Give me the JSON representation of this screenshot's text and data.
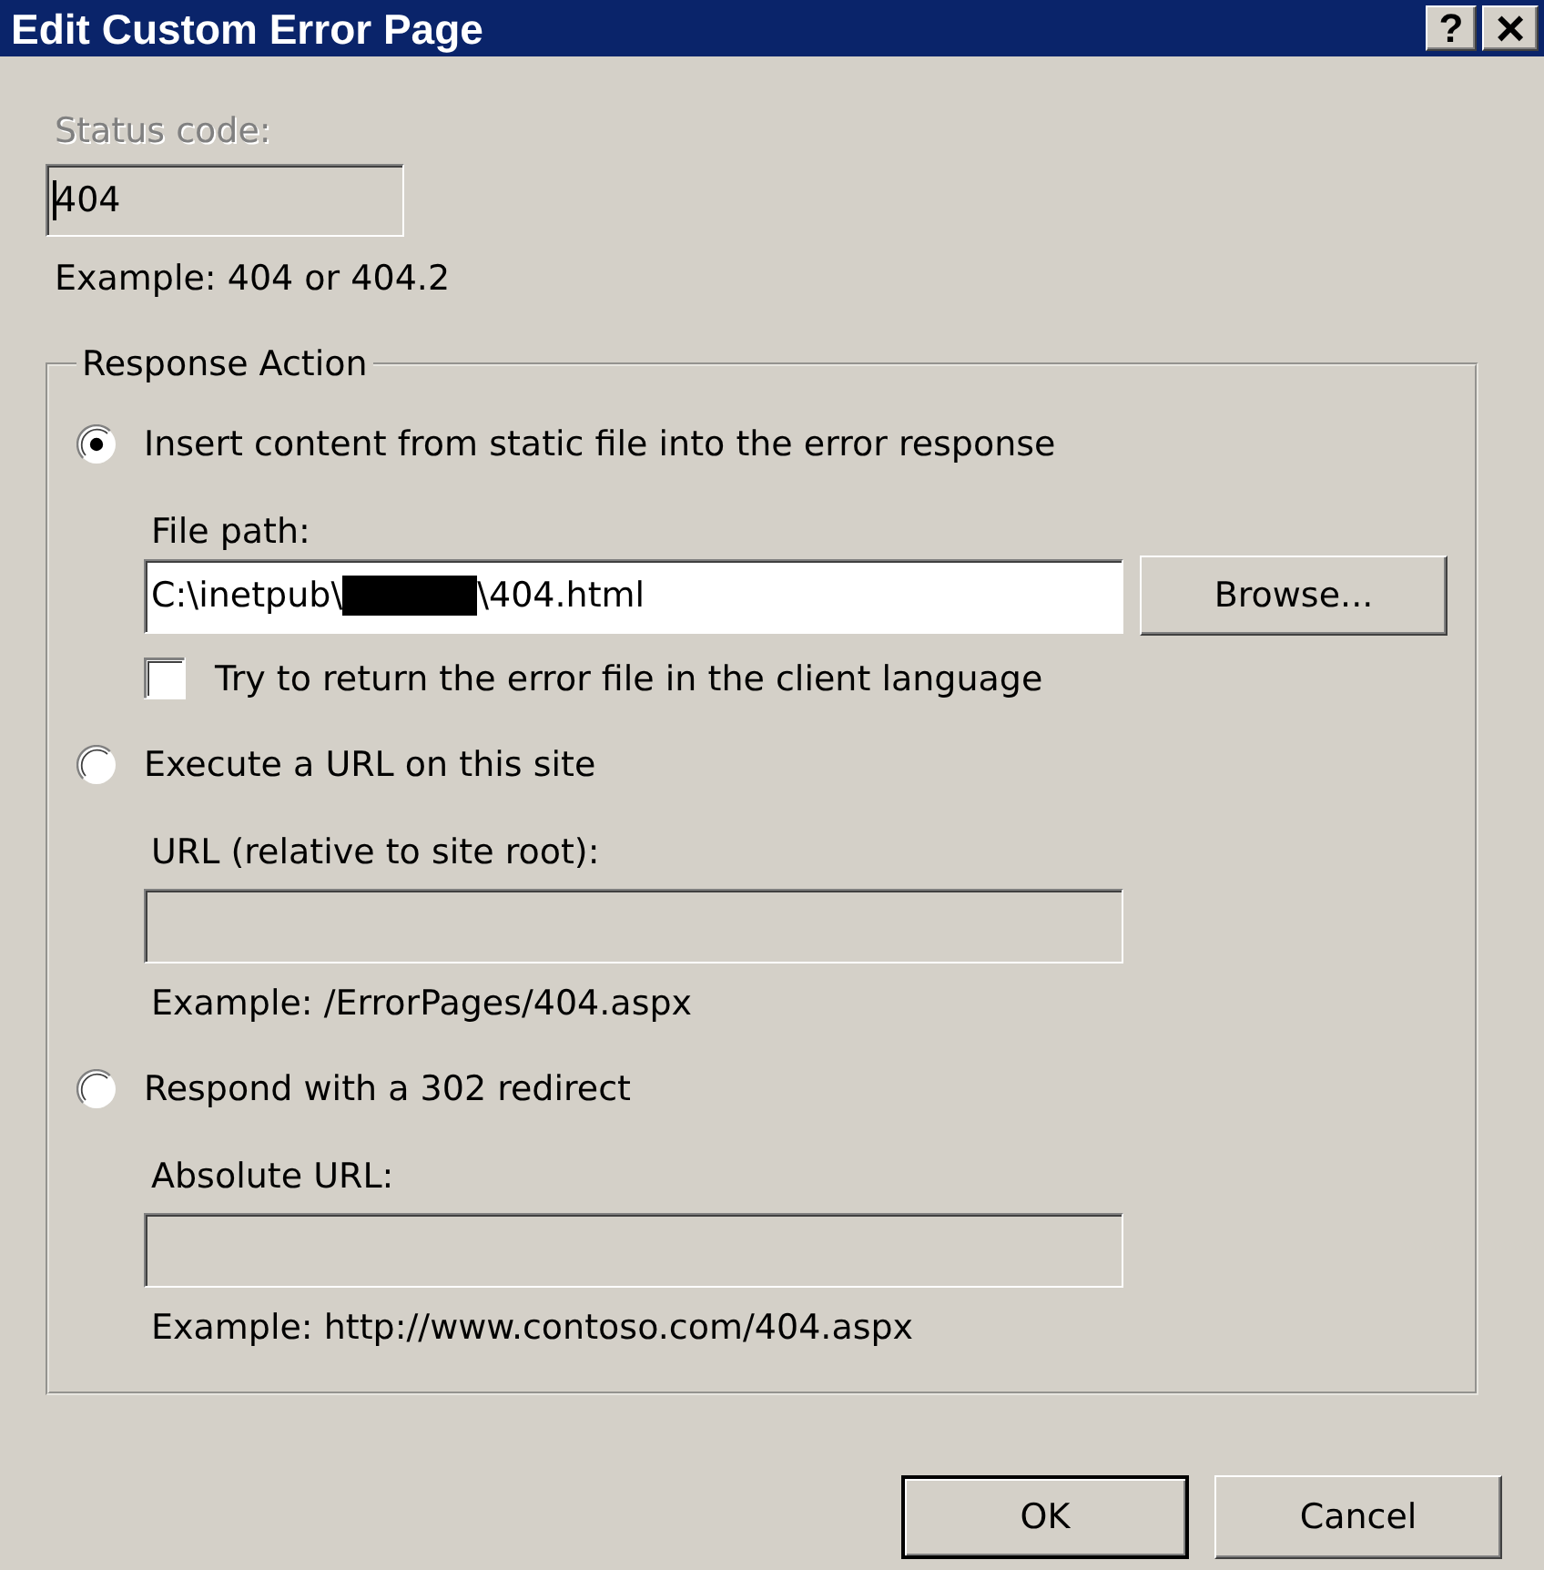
{
  "window": {
    "title": "Edit Custom Error Page",
    "controls": [
      {
        "kind": "help",
        "label": "?"
      },
      {
        "kind": "close",
        "label": "×"
      }
    ]
  },
  "status_code": {
    "label": "Status code:",
    "value": "404",
    "disabled": true,
    "focused": true,
    "example": "Example: 404 or 404.2"
  },
  "response_action": {
    "title": "Response Action",
    "options": [
      {
        "label": "Insert content from static file into the error response",
        "selected": true,
        "field_label": "File path:",
        "field": {
          "disabled": false,
          "value_parts": [
            {
              "kind": "text",
              "text": "C:\\inetpub\\"
            },
            {
              "kind": "redacted"
            },
            {
              "kind": "text",
              "text": "\\404.html"
            }
          ]
        },
        "button": "Browse...",
        "checkbox": {
          "label": "Try to return the error file in the client language",
          "checked": false
        }
      },
      {
        "label": "Execute a URL on this site",
        "selected": false,
        "field_label": "URL (relative to site root):",
        "field": {
          "disabled": true
        },
        "example": "Example: /ErrorPages/404.aspx"
      },
      {
        "label": "Respond with a 302 redirect",
        "selected": false,
        "field_label": "Absolute URL:",
        "field": {
          "disabled": true
        },
        "example": "Example: http://www.contoso.com/404.aspx"
      }
    ]
  },
  "buttons": [
    {
      "label": "OK",
      "default": true
    },
    {
      "label": "Cancel",
      "default": false
    }
  ]
}
